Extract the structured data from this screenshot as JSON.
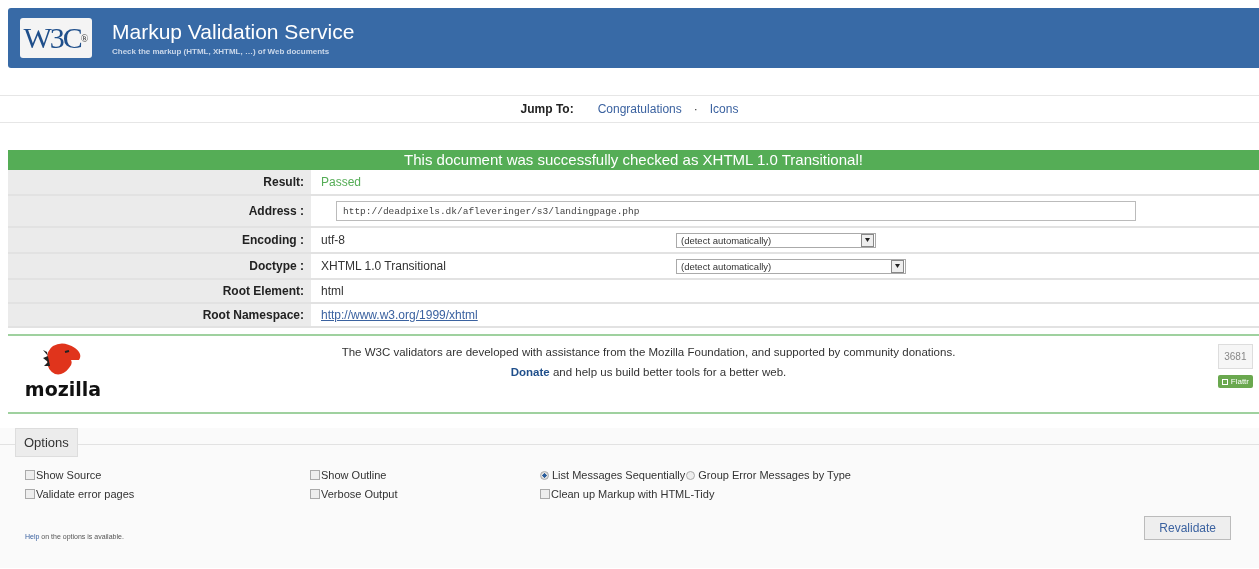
{
  "header": {
    "logo": "W3C",
    "logo_mark": "®",
    "title": "Markup Validation Service",
    "subtitle": "Check the markup (HTML, XHTML, …) of Web documents"
  },
  "jump": {
    "label": "Jump To:",
    "links": [
      "Congratulations",
      "Icons"
    ],
    "separator": "·"
  },
  "banner": "This document was successfully checked as XHTML 1.0 Transitional!",
  "rows": [
    {
      "kind": "result",
      "label": "Result:",
      "value": "Passed"
    },
    {
      "kind": "field",
      "label": "Address :",
      "value": "http://deadpixels.dk/afleveringer/s3/landingpage.php"
    },
    {
      "kind": "select",
      "label": "Encoding :",
      "value": "utf-8",
      "select": "(detect automatically)"
    },
    {
      "kind": "select",
      "label": "Doctype :",
      "value": "XHTML 1.0 Transitional",
      "select": "(detect automatically)"
    },
    {
      "kind": "text",
      "label": "Root Element:",
      "value": "html"
    },
    {
      "kind": "link",
      "label": "Root Namespace:",
      "value": "http://www.w3.org/1999/xhtml"
    }
  ],
  "sponsor": {
    "logo": "mozilla",
    "text": "The W3C validators are developed with assistance from the Mozilla Foundation, and supported by community donations.",
    "donate": "Donate",
    "donate_rest": " and help us build better tools for a better web.",
    "flattr_count": "3681",
    "flattr_button": "Flattr"
  },
  "options": {
    "title": "Options",
    "rows": [
      [
        {
          "kind": "checkbox",
          "label": "Show Source",
          "checked": false
        },
        {
          "kind": "checkbox",
          "label": "Show Outline",
          "checked": false
        },
        {
          "kind": "radio",
          "label": "List Messages Sequentially",
          "selected": true
        },
        {
          "kind": "radio",
          "label": "Group Error Messages by Type",
          "selected": false
        }
      ],
      [
        {
          "kind": "checkbox",
          "label": "Validate error pages",
          "checked": false
        },
        {
          "kind": "checkbox",
          "label": "Verbose Output",
          "checked": false
        },
        {
          "kind": "checkbox",
          "label": "Clean up Markup with HTML-Tidy",
          "checked": false
        }
      ]
    ],
    "help_link": "Help",
    "help_rest": " on the options is available.",
    "button": "Revalidate"
  }
}
